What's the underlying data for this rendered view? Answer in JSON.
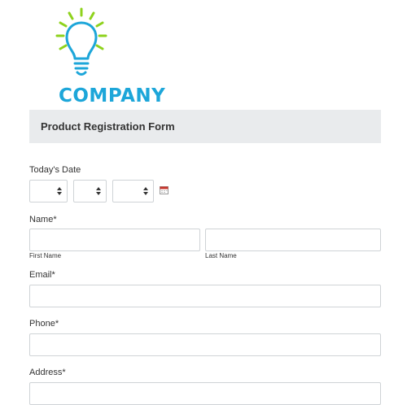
{
  "brand": {
    "name": "COMPANY",
    "logo_icon": "lightbulb-icon",
    "colors": {
      "bulb": "#1da6d9",
      "rays": "#8ed21c"
    }
  },
  "form": {
    "title": "Product Registration Form",
    "date": {
      "label": "Today's Date",
      "month_value": "",
      "day_value": "",
      "year_value": "",
      "calendar_icon": "calendar-icon"
    },
    "name": {
      "label": "Name",
      "required": "*",
      "first_sublabel": "First Name",
      "last_sublabel": "Last Name",
      "first_value": "",
      "last_value": ""
    },
    "email": {
      "label": "Email",
      "required": "*",
      "value": ""
    },
    "phone": {
      "label": "Phone",
      "required": "*",
      "value": ""
    },
    "address": {
      "label": "Address",
      "required": "*",
      "value": ""
    }
  }
}
